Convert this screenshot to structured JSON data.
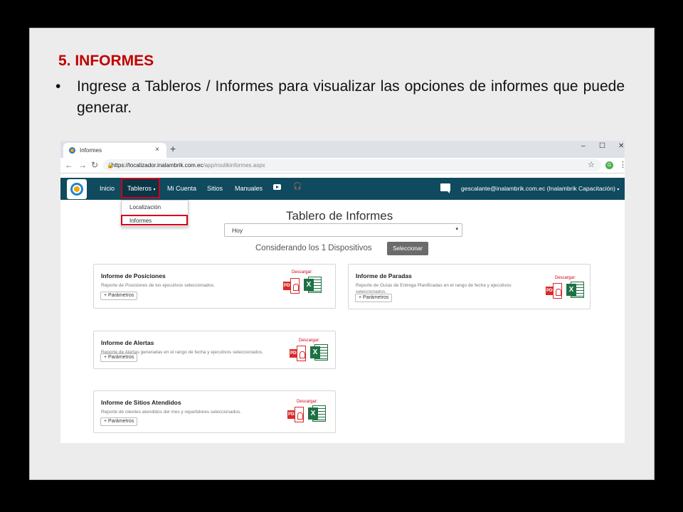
{
  "slide": {
    "title": "5. INFORMES",
    "bullet_symbol": "•",
    "bullet_text": "Ingrese a Tableros / Informes para visualizar las opciones de informes que puede generar."
  },
  "browser": {
    "tab_title": "Informes",
    "tab_close": "×",
    "new_tab": "+",
    "window_controls": [
      "–",
      "☐",
      "✕"
    ],
    "back": "←",
    "forward": "→",
    "reload": "↻",
    "lock": "🔒",
    "url_host": "https://localizador.inalambrik.com.ec",
    "url_path": "/app/routikinformes.aspx",
    "star": "☆",
    "extension_letter": "G",
    "menu": "⋮"
  },
  "nav": {
    "items": [
      "Inicio",
      "Tableros",
      "Mi Cuenta",
      "Sitios",
      "Manuales"
    ],
    "caret": "▾",
    "user": "gescalante@inalambrik.com.ec (Inalambrik Capacitación)",
    "headset": "🎧"
  },
  "dropdown": {
    "items": [
      "Localización",
      "Informes"
    ]
  },
  "page": {
    "heading": "Tablero de Informes",
    "period_selected": "Hoy",
    "select_arrow": "▾",
    "devices_text": "Considerando los 1 Dispositivos",
    "select_button": "Seleccionar"
  },
  "reports": [
    {
      "title": "Informe de Posiciones",
      "desc": "Reporte de Posiciones de los ejecutivos seleccionados.",
      "params": "+ Parámetros",
      "download": "Descargar:"
    },
    {
      "title": "Informe de Paradas",
      "desc": "Reporte de Guías de Entrega Planificadas en el rango de fecha y ejecutivos seleccionados.",
      "params": "+ Parámetros",
      "download": "Descargar:"
    },
    {
      "title": "Informe de Alertas",
      "desc": "Reporte de Alertas generadas en el rango de fecha y ejecutivos seleccionados.",
      "params": "+ Parámetros",
      "download": "Descargar:"
    },
    {
      "title": "Informe de Sitios Atendidos",
      "desc": "Reporte de clientes atendidos del mes y repartidores seleccionados.",
      "params": "+ Parámetros",
      "download": "Descargar:"
    }
  ],
  "file_icons": {
    "pdf": "PDF",
    "xls": "X"
  },
  "colors": {
    "accent_red": "#c00000",
    "nav_bg": "#0f4a5e",
    "highlight": "#d0021b"
  }
}
